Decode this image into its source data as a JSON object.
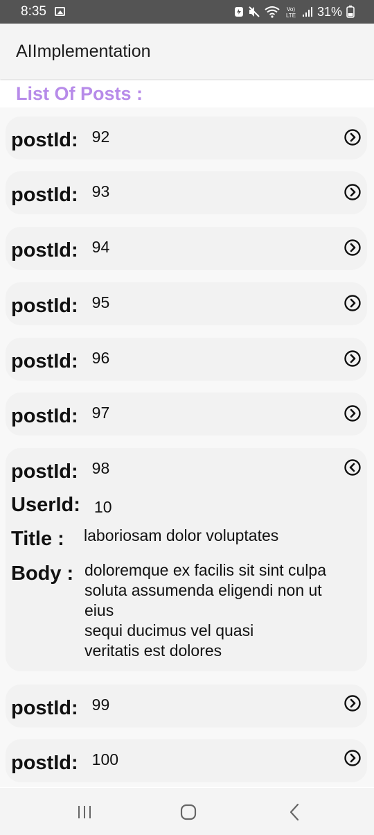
{
  "status_bar": {
    "time": "8:35",
    "battery": "31%",
    "icons": [
      "image-icon",
      "battery-saver-icon",
      "mute-icon",
      "wifi-icon",
      "volte-icon",
      "signal-icon",
      "battery-icon"
    ]
  },
  "app_bar": {
    "title": "AIImplementation"
  },
  "section": {
    "title": "List Of Posts :"
  },
  "labels": {
    "post_id": "postId:",
    "user_id": "UserId:",
    "title": "Title :",
    "body": "Body :"
  },
  "posts": [
    {
      "id": "92",
      "expanded": false
    },
    {
      "id": "93",
      "expanded": false
    },
    {
      "id": "94",
      "expanded": false
    },
    {
      "id": "95",
      "expanded": false
    },
    {
      "id": "96",
      "expanded": false
    },
    {
      "id": "97",
      "expanded": false
    },
    {
      "id": "98",
      "expanded": true,
      "user_id": "10",
      "title": "laboriosam dolor voluptates",
      "body_lines": [
        "doloremque ex facilis sit sint culpa",
        "soluta assumenda eligendi non ut",
        "eius",
        "sequi ducimus vel quasi",
        "veritatis est dolores"
      ]
    },
    {
      "id": "99",
      "expanded": false
    },
    {
      "id": "100",
      "expanded": false
    }
  ],
  "colors": {
    "accent": "#b78be9",
    "status_bar": "#545454",
    "card": "#f2f2f2"
  },
  "nav": {
    "icons": [
      "recents-icon",
      "home-icon",
      "back-icon"
    ]
  }
}
